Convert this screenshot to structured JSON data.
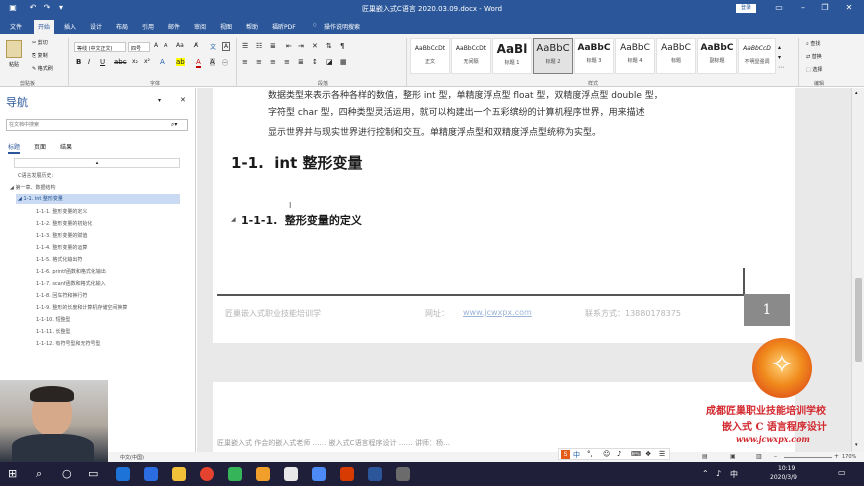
{
  "window": {
    "title": "匠巢嵌入式C语言 2020.03.09.docx - Word",
    "login_label": "登录"
  },
  "menu": {
    "tabs": [
      "文件",
      "开始",
      "插入",
      "设计",
      "布局",
      "引用",
      "邮件",
      "审阅",
      "视图",
      "帮助",
      "福昕PDF"
    ],
    "active_tab": "开始",
    "tell_me": "操作说明搜索"
  },
  "ribbon": {
    "paste_label": "粘贴",
    "cut_label": "剪切",
    "copy_label": "复制",
    "format_painter_label": "格式刷",
    "clipboard_label": "剪贴板",
    "font_name": "等线 (中文正文)",
    "font_size": "四号",
    "font_group_label": "字体",
    "paragraph_group_label": "段落",
    "styles_group_label": "样式",
    "find_label": "查找",
    "replace_label": "替换",
    "select_label": "选择",
    "editing_label": "编辑",
    "styles": [
      {
        "preview": "AaBbCcDt",
        "name": "正文"
      },
      {
        "preview": "AaBbCcDt",
        "name": "无间隔"
      },
      {
        "preview": "AaBl",
        "name": "标题 1"
      },
      {
        "preview": "AaBbC",
        "name": "标题 2"
      },
      {
        "preview": "AaBbC",
        "name": "标题 3"
      },
      {
        "preview": "AaBbC",
        "name": "标题 4"
      },
      {
        "preview": "AaBbC",
        "name": "标题"
      },
      {
        "preview": "AaBbC",
        "name": "副标题"
      },
      {
        "preview": "AaBbCcD",
        "name": "不明显强调"
      }
    ]
  },
  "navigation": {
    "title": "导航",
    "search_placeholder": "在文档中搜索",
    "tabs": [
      "标题",
      "页面",
      "结果"
    ],
    "items": [
      {
        "label": "C语言发展历史:",
        "level": 0,
        "selected": false
      },
      {
        "label": "第一章、数据结构",
        "level": 1,
        "selected": false
      },
      {
        "label": "1-1. int 整形变量",
        "level": 2,
        "selected": true
      },
      {
        "label": "1-1-1. 整形变量的定义",
        "level": 3,
        "selected": false
      },
      {
        "label": "1-1-2. 整形变量的初始化",
        "level": 3,
        "selected": false
      },
      {
        "label": "1-1-3. 整形变量的赋值",
        "level": 3,
        "selected": false
      },
      {
        "label": "1-1-4. 整形变量的运算",
        "level": 3,
        "selected": false
      },
      {
        "label": "1-1-5. 格式化输出符",
        "level": 3,
        "selected": false
      },
      {
        "label": "1-1-6. printf函数和格式化输出",
        "level": 3,
        "selected": false
      },
      {
        "label": "1-1-7. scanf函数和格式化输入",
        "level": 3,
        "selected": false
      },
      {
        "label": "1-1-8. 回车符和换行符",
        "level": 3,
        "selected": false
      },
      {
        "label": "1-1-9. 整形的长度和计算机存储空间换算",
        "level": 3,
        "selected": false
      },
      {
        "label": "1-1-10. 短整型",
        "level": 3,
        "selected": false
      },
      {
        "label": "1-1-11. 长整型",
        "level": 3,
        "selected": false
      },
      {
        "label": "1-1-12. 有符号型和无符号型",
        "level": 3,
        "selected": false
      }
    ]
  },
  "document": {
    "paragraph_lines": [
      "数据类型来表示各种各样的数值，整形 int 型，单精度浮点型 float 型，双精度浮点型 double 型，",
      "字符型 char 型，四种类型灵活运用，就可以构建出一个五彩缤纷的计算机程序世界，用来描述",
      "显示世界并与现实世界进行控制和交互。单精度浮点型和双精度浮点型统称为实型。"
    ],
    "heading1": "1-1.  int 整形变量",
    "heading2": "1-1-1.  整形变量的定义",
    "footer_school": "匠巢嵌入式职业技能培训学",
    "footer_site_label": "网址：",
    "footer_url": "www.jcwxpx.com",
    "footer_contact": "联系方式：13880178375",
    "page_number": "1",
    "page2_text": "匠巢嵌入式 作会的嵌入式老师 ……  嵌入式C语言程序设计 ……  讲师：杨…"
  },
  "watermark": {
    "line1": "成都匠巢职业技能培训学校",
    "line2": "嵌入式 C 语言程序设计",
    "line3": "www.jcwxpx.com"
  },
  "statusbar": {
    "language": "中文(中国)",
    "zoom": "170%"
  },
  "taskbar": {
    "time": "10:19",
    "date": "2020/3/9"
  },
  "colors": {
    "word_blue": "#2b579a",
    "watermark_red": "#d2282e",
    "taskbar": "#1f1f3a"
  }
}
